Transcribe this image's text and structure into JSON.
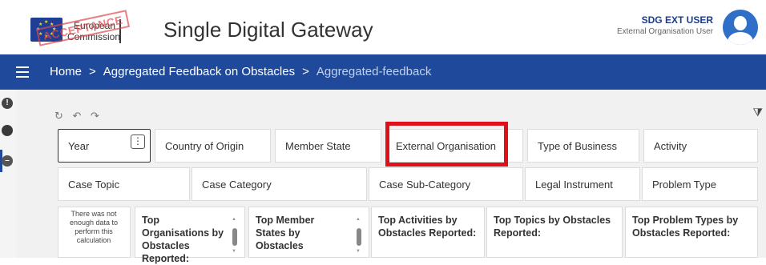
{
  "header": {
    "logo_lines": [
      "European",
      "Commission"
    ],
    "stamp_text": "ACCEPTANCE",
    "app_title": "Single Digital Gateway",
    "user_name": "SDG EXT USER",
    "user_role": "External Organisation User"
  },
  "nav": {
    "breadcrumbs": [
      "Home",
      "Aggregated Feedback on Obstacles",
      "Aggregated-feedback"
    ],
    "separator": ">"
  },
  "toolbar": {
    "icons": [
      "refresh-icon",
      "undo-icon",
      "redo-icon"
    ],
    "glyphs": "↻ ↶ ↷",
    "filter_glyph": "⧩"
  },
  "filters_row1": [
    "Year",
    "Country of Origin",
    "Member State",
    "External Organisation",
    "Type of Business",
    "Activity"
  ],
  "filters_row2": [
    "Case Topic",
    "Case Category",
    "Case Sub-Category",
    "Legal Instrument",
    "Problem Type"
  ],
  "panels": {
    "message": "There was not enough data to perform this calculation",
    "top_orgs": "Top Organisations by Obstacles Reported:",
    "top_ms": "Top Member States by Obstacles",
    "top_activities": "Top Activities by Obstacles Reported:",
    "top_topics": "Top Topics by Obstacles Reported:",
    "top_problem_types": "Top Problem Types by Obstacles Reported:"
  },
  "colors": {
    "navbar": "#1f4a9c",
    "highlight": "#e0101a",
    "user_name": "#1a3c8c"
  }
}
